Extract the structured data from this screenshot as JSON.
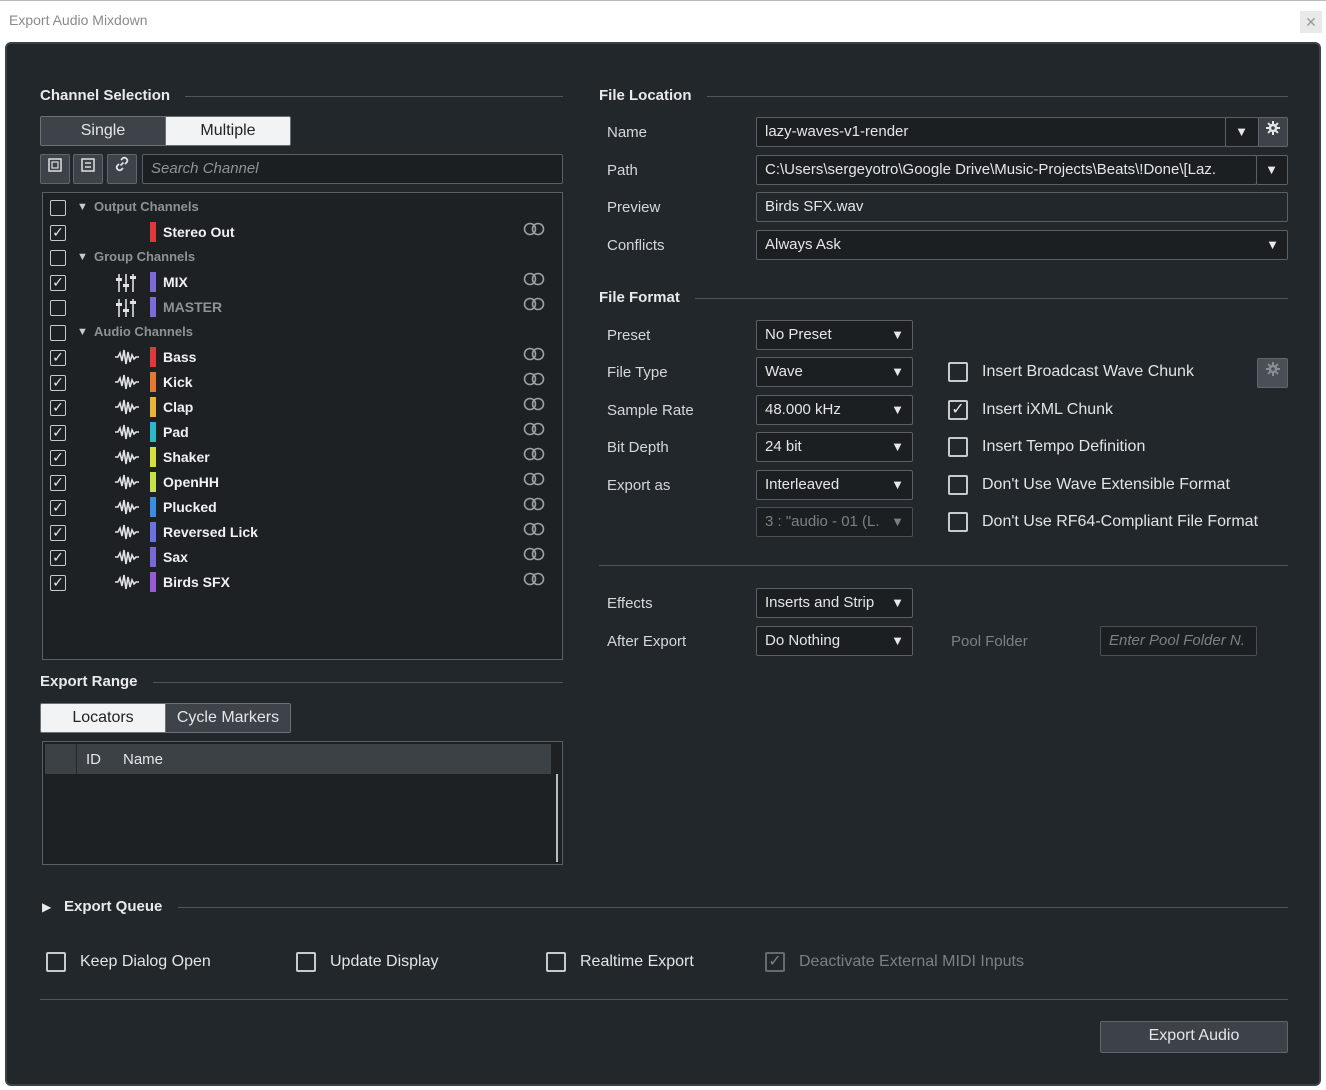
{
  "window": {
    "title": "Export Audio Mixdown",
    "close": "✕"
  },
  "channel_selection": {
    "heading": "Channel Selection",
    "modes": [
      "Single",
      "Multiple"
    ],
    "active_mode": "Multiple",
    "search_placeholder": "Search Channel",
    "groups": [
      {
        "label": "Output Channels",
        "checked": false,
        "channels": [
          {
            "name": "Stereo Out",
            "checked": true,
            "color": "#e0393b",
            "icon": "none",
            "dim": false
          }
        ]
      },
      {
        "label": "Group Channels",
        "checked": false,
        "channels": [
          {
            "name": "MIX",
            "checked": true,
            "color": "#7b6ad8",
            "icon": "group-fader-icon",
            "dim": false
          },
          {
            "name": "MASTER",
            "checked": false,
            "color": "#7b6ad8",
            "icon": "group-fader-icon",
            "dim": true
          }
        ]
      },
      {
        "label": "Audio Channels",
        "checked": false,
        "channels": [
          {
            "name": "Bass",
            "checked": true,
            "color": "#e0393b",
            "icon": "audio-wave-icon",
            "dim": false
          },
          {
            "name": "Kick",
            "checked": true,
            "color": "#e8782f",
            "icon": "audio-wave-icon",
            "dim": false
          },
          {
            "name": "Clap",
            "checked": true,
            "color": "#e8b43a",
            "icon": "audio-wave-icon",
            "dim": false
          },
          {
            "name": "Pad",
            "checked": true,
            "color": "#2bb8c8",
            "icon": "audio-wave-icon",
            "dim": false
          },
          {
            "name": "Shaker",
            "checked": true,
            "color": "#d8e040",
            "icon": "audio-wave-icon",
            "dim": false
          },
          {
            "name": "OpenHH",
            "checked": true,
            "color": "#c8e04a",
            "icon": "audio-wave-icon",
            "dim": false
          },
          {
            "name": "Plucked",
            "checked": true,
            "color": "#3a8ee0",
            "icon": "audio-wave-icon",
            "dim": false
          },
          {
            "name": "Reversed Lick",
            "checked": true,
            "color": "#6a72e0",
            "icon": "audio-wave-icon",
            "dim": false
          },
          {
            "name": "Sax",
            "checked": true,
            "color": "#7a68d8",
            "icon": "audio-wave-icon",
            "dim": false
          },
          {
            "name": "Birds SFX",
            "checked": true,
            "color": "#9a5ad8",
            "icon": "audio-wave-icon",
            "dim": false
          }
        ]
      }
    ]
  },
  "export_range": {
    "heading": "Export Range",
    "modes": [
      "Locators",
      "Cycle Markers"
    ],
    "active_mode": "Locators",
    "columns": [
      "ID",
      "Name"
    ]
  },
  "file_location": {
    "heading": "File Location",
    "name_label": "Name",
    "name_value": "lazy-waves-v1-render",
    "path_label": "Path",
    "path_value": "C:\\Users\\sergeyotro\\Google Drive\\Music-Projects\\Beats\\!Done\\[Laz.",
    "preview_label": "Preview",
    "preview_value": "Birds SFX.wav",
    "conflicts_label": "Conflicts",
    "conflicts_value": "Always Ask"
  },
  "file_format": {
    "heading": "File Format",
    "preset_label": "Preset",
    "preset_value": "No Preset",
    "file_type_label": "File Type",
    "file_type_value": "Wave",
    "sample_rate_label": "Sample Rate",
    "sample_rate_value": "48.000 kHz",
    "bit_depth_label": "Bit Depth",
    "bit_depth_value": "24 bit",
    "export_as_label": "Export as",
    "export_as_value": "Interleaved",
    "channel_value": "3 : \"audio - 01 (L.",
    "options": [
      {
        "label": "Insert Broadcast Wave Chunk",
        "checked": false
      },
      {
        "label": "Insert iXML Chunk",
        "checked": true
      },
      {
        "label": "Insert Tempo Definition",
        "checked": false
      },
      {
        "label": "Don't Use Wave Extensible Format",
        "checked": false
      },
      {
        "label": "Don't Use RF64-Compliant File Format",
        "checked": false
      }
    ]
  },
  "post": {
    "effects_label": "Effects",
    "effects_value": "Inserts and Strip",
    "after_export_label": "After Export",
    "after_export_value": "Do Nothing",
    "pool_folder_label": "Pool Folder",
    "pool_folder_placeholder": "Enter Pool Folder N."
  },
  "export_queue": {
    "heading": "Export Queue"
  },
  "bottom_options": [
    {
      "label": "Keep Dialog Open",
      "checked": false,
      "disabled": false
    },
    {
      "label": "Update Display",
      "checked": false,
      "disabled": false
    },
    {
      "label": "Realtime Export",
      "checked": false,
      "disabled": false
    },
    {
      "label": "Deactivate External MIDI Inputs",
      "checked": true,
      "disabled": true
    }
  ],
  "export_button": "Export Audio"
}
